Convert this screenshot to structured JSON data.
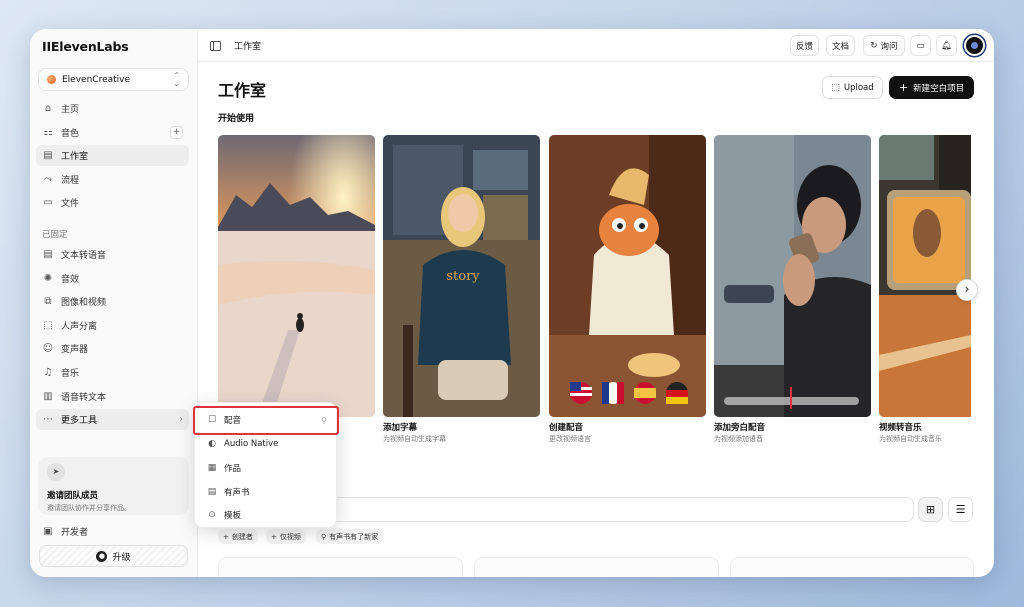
{
  "app": {
    "logo": "IIElevenLabs"
  },
  "workspace": {
    "name": "ElevenCreative",
    "chevron": "⌃⌄"
  },
  "nav": [
    {
      "label": "主页",
      "icon": "⌂"
    },
    {
      "label": "音色",
      "icon": "⚏",
      "extra": "+"
    },
    {
      "label": "工作室",
      "icon": "▤"
    },
    {
      "label": "流程",
      "icon": "⤳"
    },
    {
      "label": "文件",
      "icon": "▭"
    }
  ],
  "pinned_header": "已固定",
  "pinned": [
    {
      "label": "文本转语音",
      "icon": "▤"
    },
    {
      "label": "音效",
      "icon": "✺"
    },
    {
      "label": "图像和视频",
      "icon": "⧉"
    },
    {
      "label": "人声分离",
      "icon": "⬚"
    },
    {
      "label": "变声器",
      "icon": "☺"
    },
    {
      "label": "音乐",
      "icon": "♫"
    },
    {
      "label": "语音转文本",
      "icon": "▥"
    },
    {
      "label": "更多工具",
      "icon": "⋯",
      "arrow": "›"
    }
  ],
  "invite": {
    "icon": "➤",
    "title": "邀请团队成员",
    "desc": "邀请团队协作并分享作品。"
  },
  "developer": {
    "label": "开发者",
    "icon": "▣"
  },
  "upgrade": {
    "label": "升级"
  },
  "topbar": {
    "breadcrumb": "工作室",
    "feedback": "反馈",
    "docs": "文档",
    "ask": "询问",
    "ask_icon": "↻",
    "folder_icon": "▭",
    "bell_icon": "♫"
  },
  "main": {
    "title": "工作室",
    "upload": "Upload",
    "upload_icon": "⬚",
    "new_project": "新建空白项目",
    "new_icon": "+",
    "section": "开始使用",
    "next_icon": "›"
  },
  "cards": [
    {
      "title": "",
      "desc": ""
    },
    {
      "title": "添加字幕",
      "desc": "为视频自动生成字幕",
      "word": "story"
    },
    {
      "title": "创建配音",
      "desc": "更改视频语言"
    },
    {
      "title": "添加旁白配音",
      "desc": "为视频添加语音"
    },
    {
      "title": "视频转音乐",
      "desc": "为视频自动生成音乐"
    }
  ],
  "filters": [
    {
      "label": "创建者",
      "icon": "+"
    },
    {
      "label": "仅视频",
      "icon": "+"
    },
    {
      "label": "有声书有了新家",
      "icon": "⚲"
    }
  ],
  "view": {
    "grid_icon": "⊞",
    "list_icon": "☰"
  },
  "menu": [
    {
      "label": "配音",
      "icon": "☐",
      "pin": "⚲"
    },
    {
      "label": "Audio Native",
      "icon": "◐"
    },
    {
      "label": "作品",
      "icon": "▦"
    },
    {
      "label": "有声书",
      "icon": "▤"
    },
    {
      "label": "模板",
      "icon": "⊙"
    }
  ],
  "colors": {
    "highlight": "#e0313f",
    "primary": "#111111"
  }
}
